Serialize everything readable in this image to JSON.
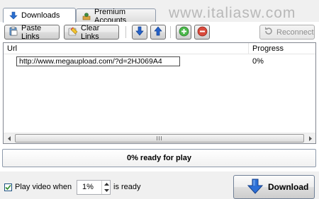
{
  "tabs": [
    {
      "label": "Downloads",
      "icon": "download-arrow-icon",
      "active": true
    },
    {
      "label": "Premium Accounts",
      "icon": "premium-accounts-icon",
      "active": false
    }
  ],
  "watermark": "www.italiasw.com",
  "toolbar": {
    "paste_label": "Paste Links",
    "clear_label": "Clear Links",
    "reconnect_label": "Reconnect"
  },
  "list": {
    "columns": {
      "url": "Url",
      "progress": "Progress"
    },
    "rows": [
      {
        "url": "http://www.megaupload.com/?d=2HJ069A4",
        "progress": "0%"
      }
    ]
  },
  "status": {
    "text": "0% ready for play"
  },
  "play": {
    "checked": true,
    "label_before": "Play video when",
    "value": "1%",
    "label_after": "is ready"
  },
  "download_button": {
    "label": "Download"
  },
  "colors": {
    "accent_blue": "#1f5fc4",
    "tab_border": "#8e9aab",
    "disabled_text": "#8d8d8d"
  }
}
